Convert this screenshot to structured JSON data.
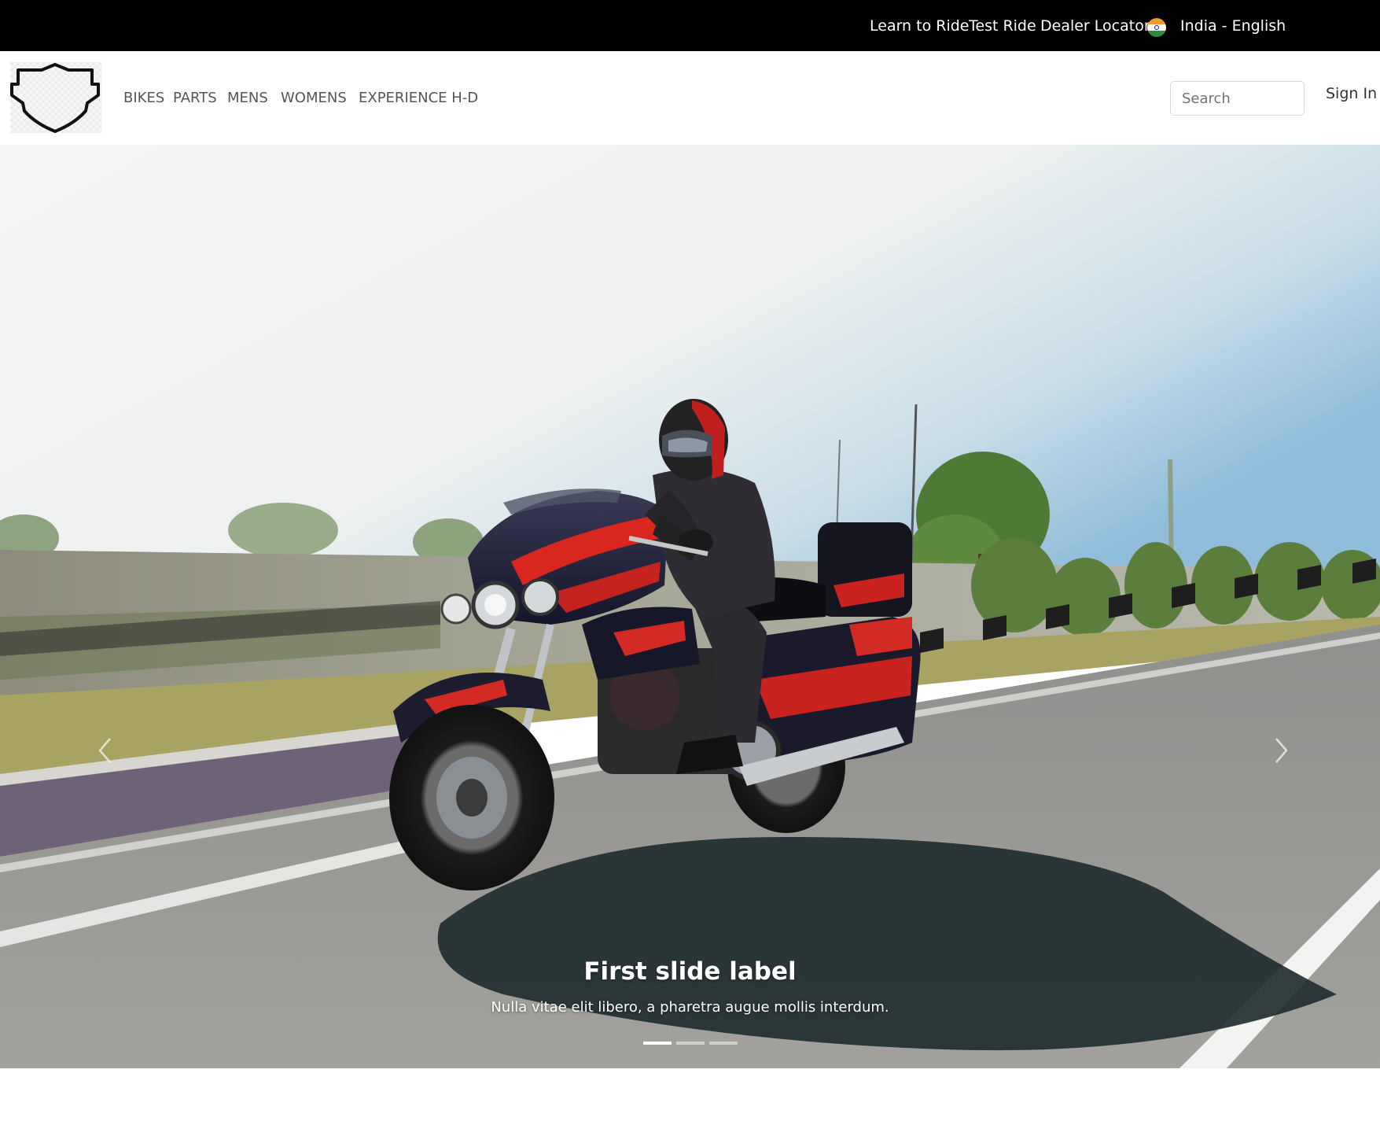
{
  "topbar": {
    "links": [
      "Learn to Ride",
      "Test Ride",
      "Dealer Locator"
    ],
    "flag_icon": "india-flag-icon",
    "locale": "India - English"
  },
  "navbar": {
    "logo_icon": "shield-logo-icon",
    "items": [
      "BIKES",
      "PARTS",
      "MENS",
      "WOMENS",
      "EXPERIENCE H-D"
    ],
    "search_placeholder": "Search",
    "search_value": "",
    "sign_in": "Sign In"
  },
  "carousel": {
    "prev_icon": "chevron-left-icon",
    "next_icon": "chevron-right-icon",
    "slide": {
      "title": "First slide label",
      "text": "Nulla vitae elit libero, a pharetra augue mollis interdum.",
      "image": "touring-motorcycle-rider-on-highway"
    },
    "slide_count": 3,
    "active_index": 0
  },
  "colors": {
    "topbar_bg": "#000000",
    "nav_text": "#555555",
    "accent_red": "#d81e1e"
  }
}
